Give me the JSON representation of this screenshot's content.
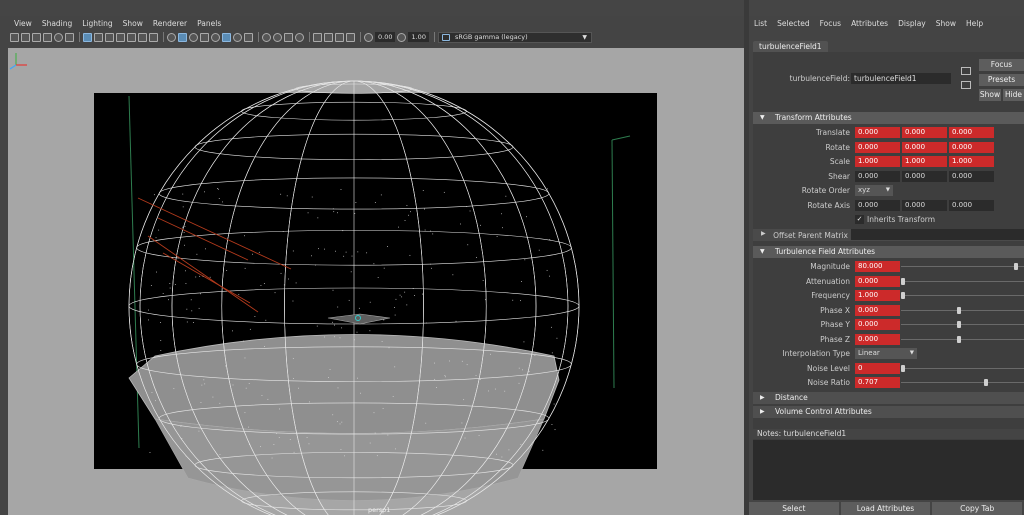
{
  "viewport": {
    "menu": [
      "View",
      "Shading",
      "Lighting",
      "Show",
      "Renderer",
      "Panels"
    ],
    "toolbar": {
      "field1": "0.00",
      "field2": "1.00",
      "colorspace": "sRGB gamma (legacy)"
    },
    "camera_label": "persp1"
  },
  "ae": {
    "menu": [
      "List",
      "Selected",
      "Focus",
      "Attributes",
      "Display",
      "Show",
      "Help"
    ],
    "tab": "turbulenceField1",
    "node_label": "turbulenceField:",
    "node_value": "turbulenceField1",
    "buttons": {
      "focus": "Focus",
      "presets": "Presets",
      "show": "Show",
      "hide": "Hide"
    },
    "transform": {
      "title": "Transform Attributes",
      "translate": {
        "label": "Translate",
        "values": [
          "0.000",
          "0.000",
          "0.000"
        ]
      },
      "rotate": {
        "label": "Rotate",
        "values": [
          "0.000",
          "0.000",
          "0.000"
        ]
      },
      "scale": {
        "label": "Scale",
        "values": [
          "1.000",
          "1.000",
          "1.000"
        ]
      },
      "shear": {
        "label": "Shear",
        "values": [
          "0.000",
          "0.000",
          "0.000"
        ]
      },
      "rotate_order": {
        "label": "Rotate Order",
        "value": "xyz"
      },
      "rotate_axis": {
        "label": "Rotate Axis",
        "values": [
          "0.000",
          "0.000",
          "0.000"
        ]
      },
      "inherits": "Inherits Transform"
    },
    "offset_parent": "Offset Parent Matrix",
    "turbulence": {
      "title": "Turbulence Field Attributes",
      "magnitude": {
        "label": "Magnitude",
        "value": "80.000",
        "slider": 0.95
      },
      "attenuation": {
        "label": "Attenuation",
        "value": "0.000",
        "slider": 0.0
      },
      "frequency": {
        "label": "Frequency",
        "value": "1.000",
        "slider": 0.0
      },
      "phase_x": {
        "label": "Phase X",
        "value": "0.000",
        "slider": 0.47
      },
      "phase_y": {
        "label": "Phase Y",
        "value": "0.000",
        "slider": 0.47
      },
      "phase_z": {
        "label": "Phase Z",
        "value": "0.000",
        "slider": 0.47
      },
      "interp": {
        "label": "Interpolation Type",
        "value": "Linear"
      },
      "noise_level": {
        "label": "Noise Level",
        "value": "0",
        "slider": 0.0
      },
      "noise_ratio": {
        "label": "Noise Ratio",
        "value": "0.707",
        "slider": 0.7
      }
    },
    "distance": "Distance",
    "volume": "Volume Control Attributes",
    "notes_label": "Notes:  turbulenceField1",
    "bottom": {
      "select": "Select",
      "load": "Load Attributes",
      "copy": "Copy Tab"
    }
  }
}
